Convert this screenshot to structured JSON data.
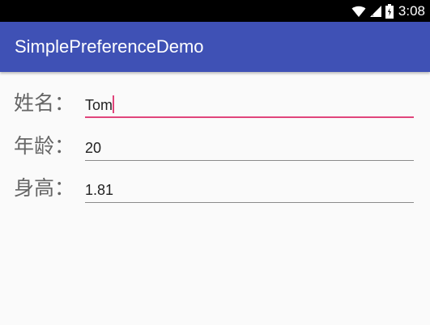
{
  "status_bar": {
    "time": "3:08",
    "icons": [
      "wifi-icon",
      "signal-icon",
      "battery-icon"
    ]
  },
  "app_bar": {
    "title": "SimplePreferenceDemo",
    "color": "#3f51b5"
  },
  "form": {
    "fields": [
      {
        "label": "姓名：",
        "value": "Tom",
        "focused": true
      },
      {
        "label": "年龄：",
        "value": "20",
        "focused": false
      },
      {
        "label": "身高：",
        "value": "1.81",
        "focused": false
      }
    ]
  },
  "colors": {
    "accent": "#e0457b",
    "primary": "#3f51b5",
    "background": "#fafafa"
  }
}
